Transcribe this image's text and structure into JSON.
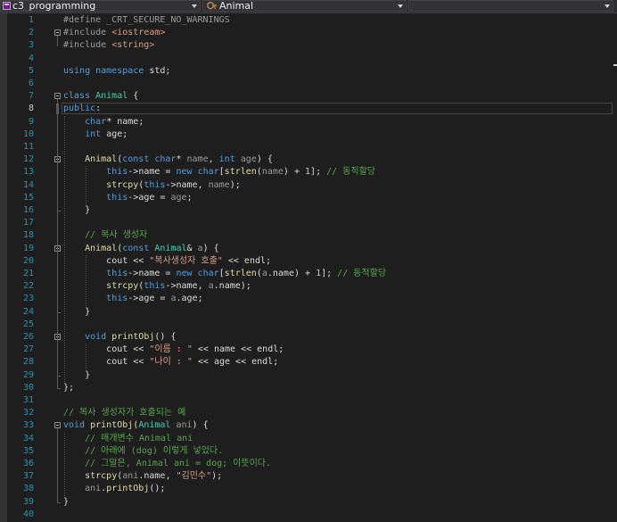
{
  "navbar": {
    "project": "c3_programming",
    "scope": "Animal",
    "member": ""
  },
  "editor": {
    "current_line": 8,
    "lines": [
      {
        "n": "1",
        "tokens": [
          {
            "t": "#define _CRT_SECURE_NO_WARNINGS",
            "c": "pp"
          }
        ]
      },
      {
        "n": "2",
        "tokens": [
          {
            "t": "#include ",
            "c": "pp"
          },
          {
            "t": "<iostream>",
            "c": "st"
          }
        ]
      },
      {
        "n": "3",
        "tokens": [
          {
            "t": "#include ",
            "c": "pp"
          },
          {
            "t": "<string>",
            "c": "st"
          }
        ]
      },
      {
        "n": "4",
        "tokens": []
      },
      {
        "n": "5",
        "tokens": [
          {
            "t": "using namespace ",
            "c": "kw"
          },
          {
            "t": "std;",
            "c": ""
          }
        ]
      },
      {
        "n": "6",
        "tokens": []
      },
      {
        "n": "7",
        "tokens": [
          {
            "t": "class ",
            "c": "kw"
          },
          {
            "t": "Animal",
            "c": "ty"
          },
          {
            "t": " {",
            "c": ""
          }
        ]
      },
      {
        "n": "8",
        "tokens": [
          {
            "t": "public",
            "c": "kw"
          },
          {
            "t": ":",
            "c": ""
          }
        ]
      },
      {
        "n": "9",
        "tokens": [
          {
            "t": "    ",
            "c": ""
          },
          {
            "t": "char",
            "c": "kw"
          },
          {
            "t": "* ",
            "c": ""
          },
          {
            "t": "name",
            "c": "mb"
          },
          {
            "t": ";",
            "c": ""
          }
        ]
      },
      {
        "n": "10",
        "tokens": [
          {
            "t": "    ",
            "c": ""
          },
          {
            "t": "int ",
            "c": "kw"
          },
          {
            "t": "age",
            "c": "mb"
          },
          {
            "t": ";",
            "c": ""
          }
        ]
      },
      {
        "n": "11",
        "tokens": []
      },
      {
        "n": "12",
        "tokens": [
          {
            "t": "    ",
            "c": ""
          },
          {
            "t": "Animal",
            "c": "fn"
          },
          {
            "t": "(",
            "c": ""
          },
          {
            "t": "const char",
            "c": "kw"
          },
          {
            "t": "* ",
            "c": ""
          },
          {
            "t": "name",
            "c": "pm"
          },
          {
            "t": ", ",
            "c": ""
          },
          {
            "t": "int ",
            "c": "kw"
          },
          {
            "t": "age",
            "c": "pm"
          },
          {
            "t": ") {",
            "c": ""
          }
        ]
      },
      {
        "n": "13",
        "tokens": [
          {
            "t": "        ",
            "c": ""
          },
          {
            "t": "this",
            "c": "kw"
          },
          {
            "t": "->",
            "c": ""
          },
          {
            "t": "name",
            "c": "mb"
          },
          {
            "t": " = ",
            "c": ""
          },
          {
            "t": "new char",
            "c": "kw"
          },
          {
            "t": "[",
            "c": ""
          },
          {
            "t": "strlen",
            "c": "fn"
          },
          {
            "t": "(",
            "c": ""
          },
          {
            "t": "name",
            "c": "pm"
          },
          {
            "t": ") + ",
            "c": ""
          },
          {
            "t": "1",
            "c": "nu"
          },
          {
            "t": "]; ",
            "c": ""
          },
          {
            "t": "// 동적할당",
            "c": "cm"
          }
        ]
      },
      {
        "n": "14",
        "tokens": [
          {
            "t": "        ",
            "c": ""
          },
          {
            "t": "strcpy",
            "c": "fn"
          },
          {
            "t": "(",
            "c": ""
          },
          {
            "t": "this",
            "c": "kw"
          },
          {
            "t": "->",
            "c": ""
          },
          {
            "t": "name",
            "c": "mb"
          },
          {
            "t": ", ",
            "c": ""
          },
          {
            "t": "name",
            "c": "pm"
          },
          {
            "t": ");",
            "c": ""
          }
        ]
      },
      {
        "n": "15",
        "tokens": [
          {
            "t": "        ",
            "c": ""
          },
          {
            "t": "this",
            "c": "kw"
          },
          {
            "t": "->",
            "c": ""
          },
          {
            "t": "age",
            "c": "mb"
          },
          {
            "t": " = ",
            "c": ""
          },
          {
            "t": "age",
            "c": "pm"
          },
          {
            "t": ";",
            "c": ""
          }
        ]
      },
      {
        "n": "16",
        "tokens": [
          {
            "t": "    }",
            "c": ""
          }
        ]
      },
      {
        "n": "17",
        "tokens": []
      },
      {
        "n": "18",
        "tokens": [
          {
            "t": "    ",
            "c": ""
          },
          {
            "t": "// 복사 생성자",
            "c": "cm"
          }
        ]
      },
      {
        "n": "19",
        "tokens": [
          {
            "t": "    ",
            "c": ""
          },
          {
            "t": "Animal",
            "c": "fn"
          },
          {
            "t": "(",
            "c": ""
          },
          {
            "t": "const ",
            "c": "kw"
          },
          {
            "t": "Animal",
            "c": "ty"
          },
          {
            "t": "& ",
            "c": ""
          },
          {
            "t": "a",
            "c": "pm"
          },
          {
            "t": ") {",
            "c": ""
          }
        ]
      },
      {
        "n": "20",
        "tokens": [
          {
            "t": "        ",
            "c": ""
          },
          {
            "t": "cout",
            "c": ""
          },
          {
            "t": " << ",
            "c": ""
          },
          {
            "t": "\"복사생성자 호출\"",
            "c": "st"
          },
          {
            "t": " << ",
            "c": ""
          },
          {
            "t": "endl",
            "c": ""
          },
          {
            "t": ";",
            "c": ""
          }
        ]
      },
      {
        "n": "21",
        "tokens": [
          {
            "t": "        ",
            "c": ""
          },
          {
            "t": "this",
            "c": "kw"
          },
          {
            "t": "->",
            "c": ""
          },
          {
            "t": "name",
            "c": "mb"
          },
          {
            "t": " = ",
            "c": ""
          },
          {
            "t": "new char",
            "c": "kw"
          },
          {
            "t": "[",
            "c": ""
          },
          {
            "t": "strlen",
            "c": "fn"
          },
          {
            "t": "(",
            "c": ""
          },
          {
            "t": "a",
            "c": "pm"
          },
          {
            "t": ".",
            "c": ""
          },
          {
            "t": "name",
            "c": "mb"
          },
          {
            "t": ") + ",
            "c": ""
          },
          {
            "t": "1",
            "c": "nu"
          },
          {
            "t": "]; ",
            "c": ""
          },
          {
            "t": "// 동적할당",
            "c": "cm"
          }
        ]
      },
      {
        "n": "22",
        "tokens": [
          {
            "t": "        ",
            "c": ""
          },
          {
            "t": "strcpy",
            "c": "fn"
          },
          {
            "t": "(",
            "c": ""
          },
          {
            "t": "this",
            "c": "kw"
          },
          {
            "t": "->",
            "c": ""
          },
          {
            "t": "name",
            "c": "mb"
          },
          {
            "t": ", ",
            "c": ""
          },
          {
            "t": "a",
            "c": "pm"
          },
          {
            "t": ".",
            "c": ""
          },
          {
            "t": "name",
            "c": "mb"
          },
          {
            "t": ");",
            "c": ""
          }
        ]
      },
      {
        "n": "23",
        "tokens": [
          {
            "t": "        ",
            "c": ""
          },
          {
            "t": "this",
            "c": "kw"
          },
          {
            "t": "->",
            "c": ""
          },
          {
            "t": "age",
            "c": "mb"
          },
          {
            "t": " = ",
            "c": ""
          },
          {
            "t": "a",
            "c": "pm"
          },
          {
            "t": ".",
            "c": ""
          },
          {
            "t": "age",
            "c": "mb"
          },
          {
            "t": ";",
            "c": ""
          }
        ]
      },
      {
        "n": "24",
        "tokens": [
          {
            "t": "    }",
            "c": ""
          }
        ]
      },
      {
        "n": "25",
        "tokens": []
      },
      {
        "n": "26",
        "tokens": [
          {
            "t": "    ",
            "c": ""
          },
          {
            "t": "void ",
            "c": "kw"
          },
          {
            "t": "printObj",
            "c": "fn"
          },
          {
            "t": "() {",
            "c": ""
          }
        ]
      },
      {
        "n": "27",
        "tokens": [
          {
            "t": "        ",
            "c": ""
          },
          {
            "t": "cout",
            "c": ""
          },
          {
            "t": " << ",
            "c": ""
          },
          {
            "t": "\"이름 : \"",
            "c": "st"
          },
          {
            "t": " << ",
            "c": ""
          },
          {
            "t": "name",
            "c": "mb"
          },
          {
            "t": " << ",
            "c": ""
          },
          {
            "t": "endl",
            "c": ""
          },
          {
            "t": ";",
            "c": ""
          }
        ]
      },
      {
        "n": "28",
        "tokens": [
          {
            "t": "        ",
            "c": ""
          },
          {
            "t": "cout",
            "c": ""
          },
          {
            "t": " << ",
            "c": ""
          },
          {
            "t": "\"나이 : \"",
            "c": "st"
          },
          {
            "t": " << ",
            "c": ""
          },
          {
            "t": "age",
            "c": "mb"
          },
          {
            "t": " << ",
            "c": ""
          },
          {
            "t": "endl",
            "c": ""
          },
          {
            "t": ";",
            "c": ""
          }
        ]
      },
      {
        "n": "29",
        "tokens": [
          {
            "t": "    }",
            "c": ""
          }
        ]
      },
      {
        "n": "30",
        "tokens": [
          {
            "t": "};",
            "c": ""
          }
        ]
      },
      {
        "n": "31",
        "tokens": []
      },
      {
        "n": "32",
        "tokens": [
          {
            "t": "// 복사 생성자가 호출되는 예",
            "c": "cm"
          }
        ]
      },
      {
        "n": "33",
        "tokens": [
          {
            "t": "void ",
            "c": "kw"
          },
          {
            "t": "printObj",
            "c": "fn"
          },
          {
            "t": "(",
            "c": ""
          },
          {
            "t": "Animal ",
            "c": "ty"
          },
          {
            "t": "ani",
            "c": "pm"
          },
          {
            "t": ") {",
            "c": ""
          }
        ]
      },
      {
        "n": "34",
        "tokens": [
          {
            "t": "    ",
            "c": ""
          },
          {
            "t": "// 매개변수 Animal ani",
            "c": "cm"
          }
        ]
      },
      {
        "n": "35",
        "tokens": [
          {
            "t": "    ",
            "c": ""
          },
          {
            "t": "// 아래에 (dog) 이렇게 넣었다.",
            "c": "cm"
          }
        ]
      },
      {
        "n": "36",
        "tokens": [
          {
            "t": "    ",
            "c": ""
          },
          {
            "t": "// 그말은, Animal ani = dog; 이뜻이다.",
            "c": "cm"
          }
        ]
      },
      {
        "n": "37",
        "tokens": [
          {
            "t": "    ",
            "c": ""
          },
          {
            "t": "strcpy",
            "c": "fn"
          },
          {
            "t": "(",
            "c": ""
          },
          {
            "t": "ani",
            "c": "pm"
          },
          {
            "t": ".",
            "c": ""
          },
          {
            "t": "name",
            "c": "mb"
          },
          {
            "t": ", ",
            "c": ""
          },
          {
            "t": "\"김민수\"",
            "c": "st"
          },
          {
            "t": ");",
            "c": ""
          }
        ]
      },
      {
        "n": "38",
        "tokens": [
          {
            "t": "    ",
            "c": ""
          },
          {
            "t": "ani",
            "c": "pm"
          },
          {
            "t": ".",
            "c": ""
          },
          {
            "t": "printObj",
            "c": "fn"
          },
          {
            "t": "();",
            "c": ""
          }
        ]
      },
      {
        "n": "39",
        "tokens": [
          {
            "t": "}",
            "c": ""
          }
        ]
      },
      {
        "n": "40",
        "tokens": []
      }
    ]
  },
  "colors": {
    "background": "#1e1e1e",
    "keyword": "#569cd6",
    "type": "#4ec9b0",
    "function": "#dcdcaa",
    "string": "#d69d85",
    "comment": "#57a64a",
    "line_number": "#2b91af"
  },
  "icons": [
    "project-icon",
    "class-scope-icon",
    "dropdown-arrow-icon",
    "collapse-outline-icon"
  ]
}
